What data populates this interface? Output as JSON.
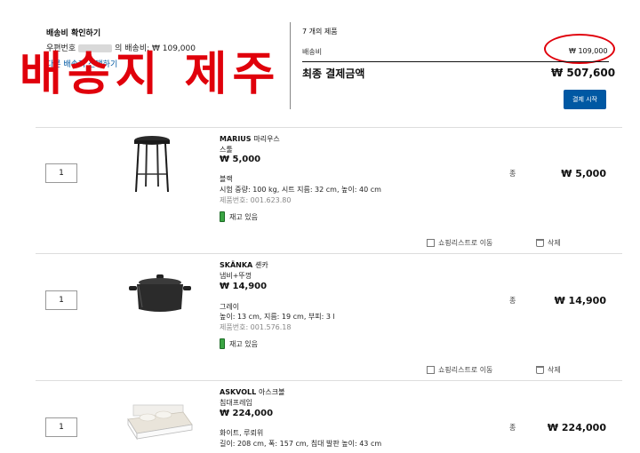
{
  "shipping": {
    "title": "배송비 확인하기",
    "postcode_prefix": "우편번호",
    "postcode_suffix": "의 배송비: ₩ 109,000",
    "change_link": "다른 배송지 선택하기",
    "overlay_text": "배송지 제주"
  },
  "summary": {
    "count": "7 개의 제품",
    "fee_label": "배송비",
    "fee_value": "₩ 109,000",
    "total_label": "최종 결제금액",
    "total_value": "₩ 507,600",
    "checkout_label": "결제 시작"
  },
  "actions": {
    "move_label": "쇼핑리스트로 이동",
    "delete_label": "삭제"
  },
  "products": [
    {
      "qty": "1",
      "name": "MARIUS",
      "name_kr": "마리우스",
      "type": "스툴",
      "price": "₩ 5,000",
      "color": "블랙",
      "dims": "시험 중량: 100 kg, 시트 지름: 32 cm, 높이: 40 cm",
      "part_no": "제품번호: 001.623.80",
      "stock": "재고 있음",
      "unit": "종",
      "row_price": "₩ 5,000"
    },
    {
      "qty": "1",
      "name": "SKÄNKA",
      "name_kr": "셴카",
      "type": "냄비+뚜껑",
      "price": "₩ 14,900",
      "color": "그레이",
      "dims": "높이: 13 cm, 지름: 19 cm, 부피: 3 l",
      "part_no": "제품번호: 001.576.18",
      "stock": "재고 있음",
      "unit": "종",
      "row_price": "₩ 14,900"
    },
    {
      "qty": "1",
      "name": "ASKVOLL",
      "name_kr": "아스크볼",
      "type": "침대프레임",
      "price": "₩ 224,000",
      "color": "화이트, 루뢰위",
      "dims": "길이: 208 cm, 폭: 157 cm, 침대 발판 높이: 43 cm",
      "part_no": "",
      "stock": "",
      "unit": "종",
      "row_price": "₩ 224,000"
    }
  ]
}
